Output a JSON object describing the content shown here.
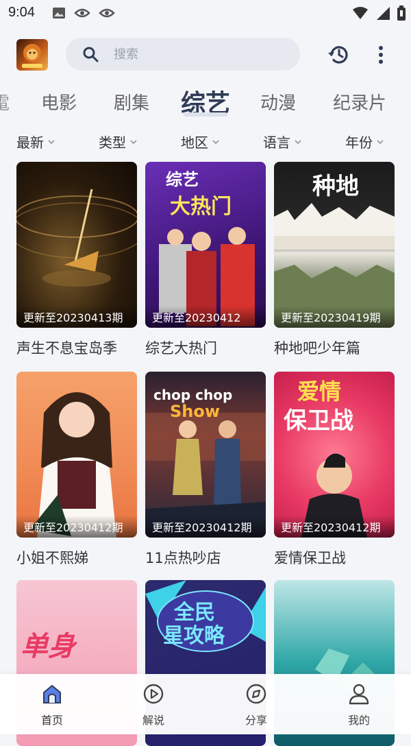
{
  "status_bar": {
    "time": "9:04"
  },
  "search": {
    "placeholder": "搜索"
  },
  "tabs": [
    {
      "label": "電"
    },
    {
      "label": "电影"
    },
    {
      "label": "剧集"
    },
    {
      "label": "综艺",
      "active": true
    },
    {
      "label": "动漫"
    },
    {
      "label": "纪录片"
    }
  ],
  "filters": [
    {
      "label": "最新"
    },
    {
      "label": "类型"
    },
    {
      "label": "地区"
    },
    {
      "label": "语言"
    },
    {
      "label": "年份"
    }
  ],
  "items": [
    {
      "title": "声生不息宝岛季",
      "badge": "更新至20230413期"
    },
    {
      "title": "综艺大热门",
      "badge": "更新至20230412"
    },
    {
      "title": "种地吧少年篇",
      "badge": "更新至20230419期"
    },
    {
      "title": "小姐不熙娣",
      "badge": "更新至20230412期"
    },
    {
      "title": "11点热吵店",
      "badge": "更新至20230412期"
    },
    {
      "title": "爱情保卫战",
      "badge": "更新至20230412期"
    },
    {
      "title": "",
      "badge": ""
    },
    {
      "title": "",
      "badge": ""
    },
    {
      "title": "",
      "badge": ""
    }
  ],
  "poster_text": {
    "p2_a": "综艺",
    "p2_b": "大热门",
    "p3_a": "种地",
    "p5_a": "chop chop",
    "p5_b": "Show",
    "p6_a": "爱情",
    "p6_b": "保卫战",
    "p7_a": "单身",
    "p8_a": "全民",
    "p8_b": "星攻略"
  },
  "bottom_nav": [
    {
      "label": "首页",
      "icon": "home-icon",
      "active": true
    },
    {
      "label": "解说",
      "icon": "play-circle-icon"
    },
    {
      "label": "分享",
      "icon": "compass-icon"
    },
    {
      "label": "我的",
      "icon": "person-icon"
    }
  ],
  "colors": {
    "accent": "#2f3b55",
    "nav_active": "#4a6fe0"
  }
}
